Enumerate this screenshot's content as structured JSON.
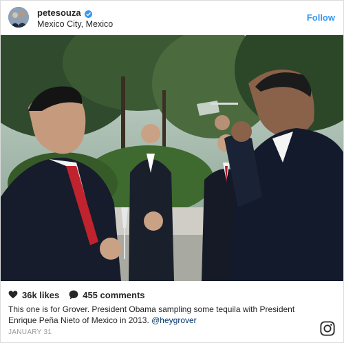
{
  "header": {
    "username": "petesouza",
    "location": "Mexico City, Mexico",
    "follow_label": "Follow"
  },
  "post": {
    "likes": "36k likes",
    "comments": "455 comments",
    "caption_text": "This one is for Grover. President Obama sampling some tequila with President Enrique Peña Nieto of Mexico in 2013. ",
    "caption_mention": "@heygrover",
    "date": "JANUARY 31"
  },
  "colors": {
    "accent": "#3897f0",
    "verified": "#3897f0",
    "muted": "#999999"
  },
  "icons": {
    "verified": "verified-badge-icon",
    "likes": "heart-icon",
    "comments": "comment-bubble-icon",
    "brand": "instagram-icon"
  }
}
